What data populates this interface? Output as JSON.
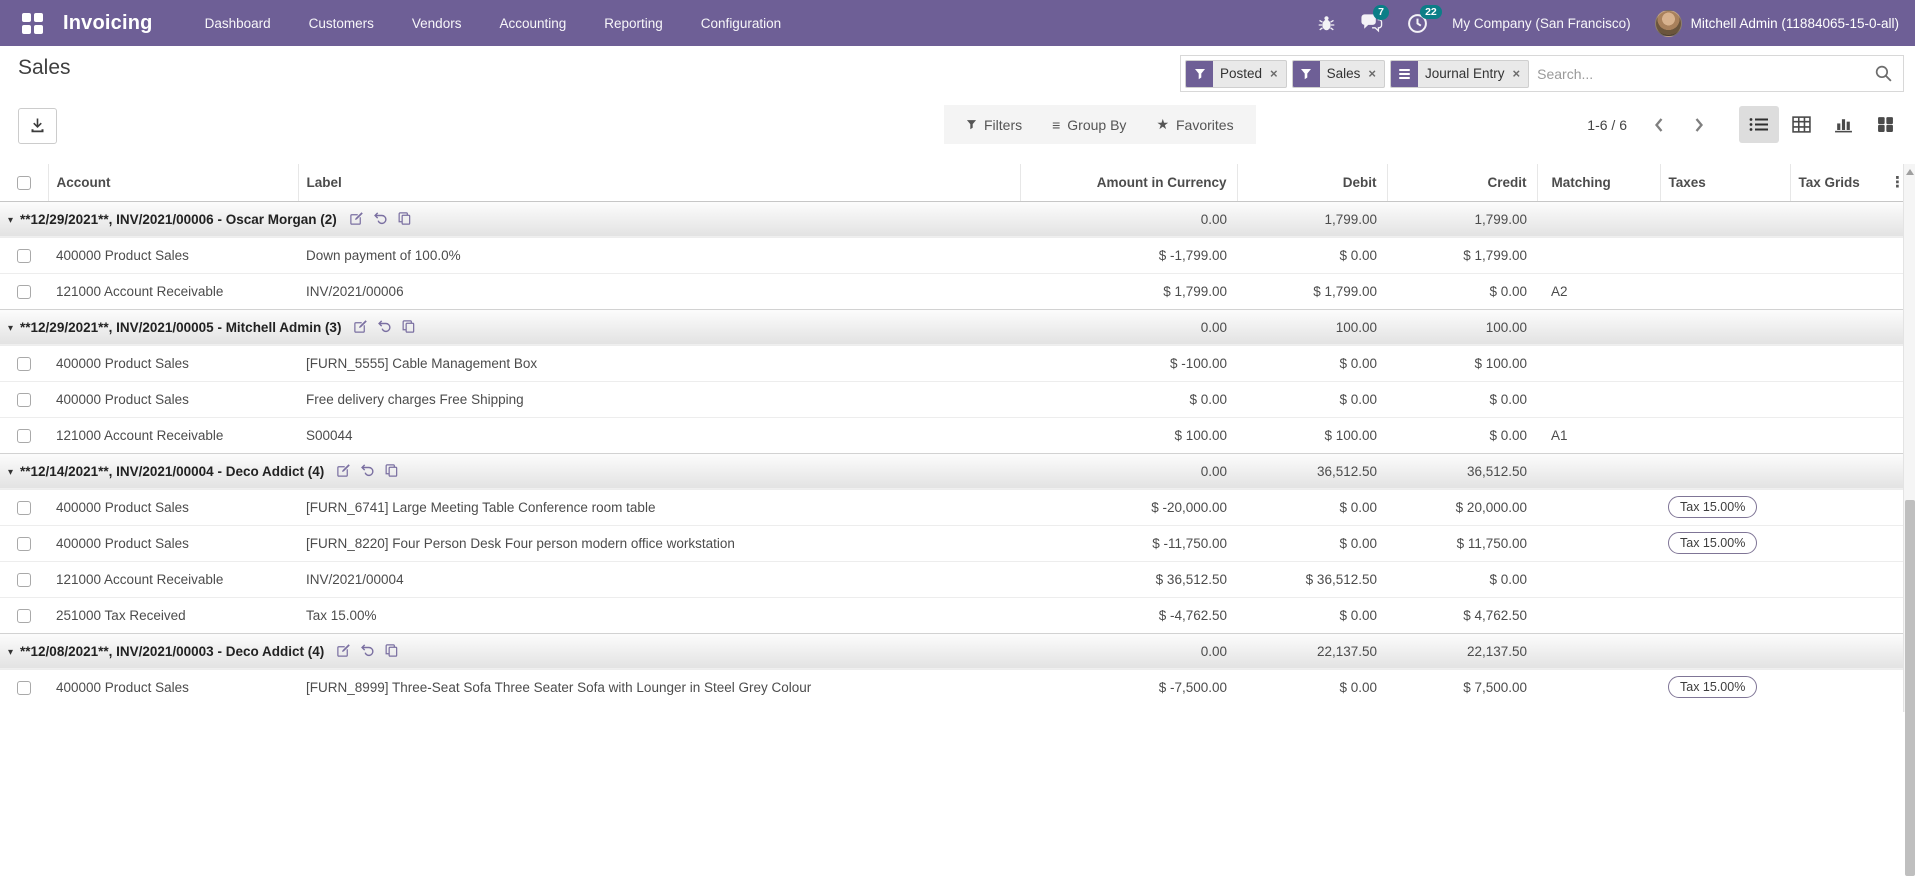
{
  "colors": {
    "brand": "#6e5f96",
    "badge": "#0b7e87"
  },
  "navbar": {
    "app_name": "Invoicing",
    "menus": [
      "Dashboard",
      "Customers",
      "Vendors",
      "Accounting",
      "Reporting",
      "Configuration"
    ],
    "messages_badge": "7",
    "activities_badge": "22",
    "company": "My Company (San Francisco)",
    "user": "Mitchell Admin (11884065-15-0-all)"
  },
  "control_panel": {
    "title": "Sales",
    "facets": [
      {
        "label": "Posted",
        "icon": "filter-icon"
      },
      {
        "label": "Sales",
        "icon": "filter-icon"
      },
      {
        "label": "Journal Entry",
        "icon": "journal-icon"
      }
    ],
    "search_placeholder": "Search...",
    "filters_label": "Filters",
    "group_by_label": "Group By",
    "favorites_label": "Favorites",
    "pager": "1-6 / 6"
  },
  "table": {
    "columns": [
      "Account",
      "Label",
      "Amount in Currency",
      "Debit",
      "Credit",
      "Matching",
      "Taxes",
      "Tax Grids"
    ],
    "rows": [
      {
        "type": "group",
        "label": "**12/29/2021**, INV/2021/00006 - Oscar Morgan (2)",
        "amount": "0.00",
        "debit": "1,799.00",
        "credit": "1,799.00"
      },
      {
        "type": "line",
        "account": "400000 Product Sales",
        "label": "Down payment of 100.0%",
        "amount": "$ -1,799.00",
        "debit": "$ 0.00",
        "credit": "$ 1,799.00",
        "matching": "",
        "tax": ""
      },
      {
        "type": "line",
        "account": "121000 Account Receivable",
        "label": "INV/2021/00006",
        "amount": "$ 1,799.00",
        "debit": "$ 1,799.00",
        "credit": "$ 0.00",
        "matching": "A2",
        "tax": ""
      },
      {
        "type": "group",
        "label": "**12/29/2021**, INV/2021/00005 - Mitchell Admin (3)",
        "amount": "0.00",
        "debit": "100.00",
        "credit": "100.00"
      },
      {
        "type": "line",
        "account": "400000 Product Sales",
        "label": "[FURN_5555] Cable Management Box",
        "amount": "$ -100.00",
        "debit": "$ 0.00",
        "credit": "$ 100.00",
        "matching": "",
        "tax": ""
      },
      {
        "type": "line",
        "account": "400000 Product Sales",
        "label": "Free delivery charges Free Shipping",
        "amount": "$ 0.00",
        "debit": "$ 0.00",
        "credit": "$ 0.00",
        "matching": "",
        "tax": ""
      },
      {
        "type": "line",
        "account": "121000 Account Receivable",
        "label": "S00044",
        "amount": "$ 100.00",
        "debit": "$ 100.00",
        "credit": "$ 0.00",
        "matching": "A1",
        "tax": ""
      },
      {
        "type": "group",
        "label": "**12/14/2021**, INV/2021/00004 - Deco Addict (4)",
        "amount": "0.00",
        "debit": "36,512.50",
        "credit": "36,512.50"
      },
      {
        "type": "line",
        "account": "400000 Product Sales",
        "label": "[FURN_6741] Large Meeting Table Conference room table",
        "amount": "$ -20,000.00",
        "debit": "$ 0.00",
        "credit": "$ 20,000.00",
        "matching": "",
        "tax": "Tax 15.00%"
      },
      {
        "type": "line",
        "account": "400000 Product Sales",
        "label": "[FURN_8220] Four Person Desk Four person modern office workstation",
        "amount": "$ -11,750.00",
        "debit": "$ 0.00",
        "credit": "$ 11,750.00",
        "matching": "",
        "tax": "Tax 15.00%"
      },
      {
        "type": "line",
        "account": "121000 Account Receivable",
        "label": "INV/2021/00004",
        "amount": "$ 36,512.50",
        "debit": "$ 36,512.50",
        "credit": "$ 0.00",
        "matching": "",
        "tax": ""
      },
      {
        "type": "line",
        "account": "251000 Tax Received",
        "label": "Tax 15.00%",
        "amount": "$ -4,762.50",
        "debit": "$ 0.00",
        "credit": "$ 4,762.50",
        "matching": "",
        "tax": ""
      },
      {
        "type": "group",
        "label": "**12/08/2021**, INV/2021/00003 - Deco Addict (4)",
        "amount": "0.00",
        "debit": "22,137.50",
        "credit": "22,137.50"
      },
      {
        "type": "line",
        "account": "400000 Product Sales",
        "label": "[FURN_8999] Three-Seat Sofa Three Seater Sofa with Lounger in Steel Grey Colour",
        "amount": "$ -7,500.00",
        "debit": "$ 0.00",
        "credit": "$ 7,500.00",
        "matching": "",
        "tax": "Tax 15.00%"
      }
    ]
  }
}
